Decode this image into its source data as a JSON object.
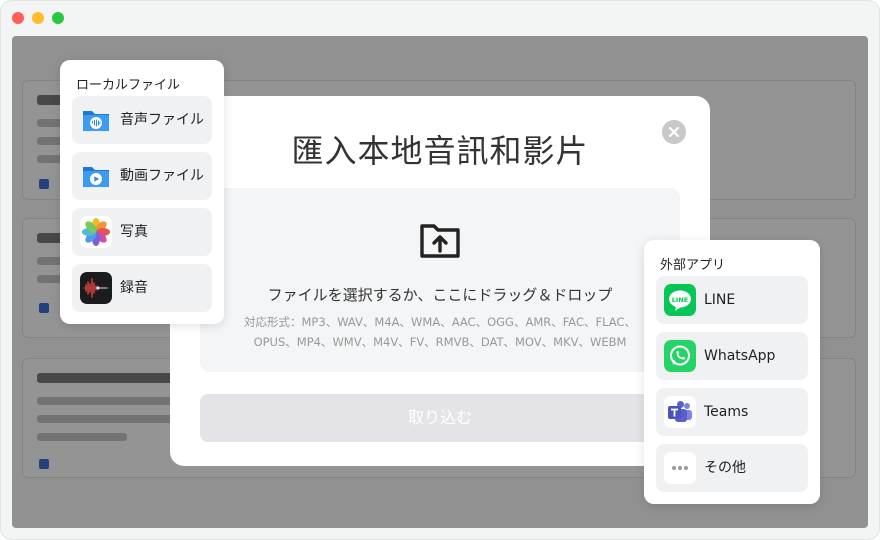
{
  "modal": {
    "title": "匯入本地音訊和影片",
    "dropzone_text": "ファイルを選択するか、ここにドラッグ＆ドロップ",
    "formats_line1": "対応形式：MP3、WAV、M4A、WMA、AAC、OGG、AMR、FAC、FLAC、",
    "formats_line2": "OPUS、MP4、WMV、M4V、FV、RMVB、DAT、MOV、MKV、WEBM",
    "import_label": "取り込む"
  },
  "local_files": {
    "title": "ローカルファイル",
    "items": [
      {
        "label": "音声ファイル",
        "icon": "audio-folder-icon"
      },
      {
        "label": "動画ファイル",
        "icon": "video-folder-icon"
      },
      {
        "label": "写真",
        "icon": "photos-icon"
      },
      {
        "label": "録音",
        "icon": "voice-memos-icon"
      }
    ]
  },
  "external_apps": {
    "title": "外部アプリ",
    "items": [
      {
        "label": "LINE",
        "icon": "line-icon"
      },
      {
        "label": "WhatsApp",
        "icon": "whatsapp-icon"
      },
      {
        "label": "Teams",
        "icon": "teams-icon"
      },
      {
        "label": "その他",
        "icon": "more-icon"
      }
    ]
  },
  "colors": {
    "accent_blue": "#2f88e8",
    "line_green": "#06c755",
    "whatsapp_green": "#25d366",
    "teams_purple": "#5b5fc7"
  }
}
